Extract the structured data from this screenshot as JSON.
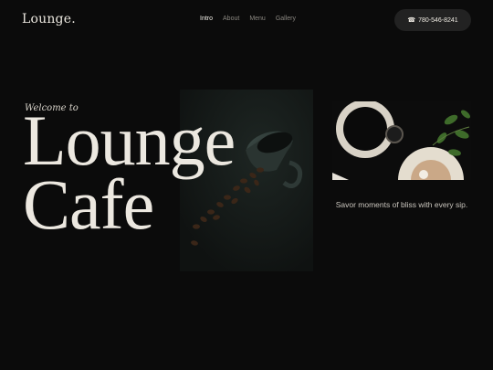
{
  "header": {
    "logo": "Lounge.",
    "nav": [
      {
        "label": "Intro",
        "active": true
      },
      {
        "label": "About",
        "active": false
      },
      {
        "label": "Menu",
        "active": false
      },
      {
        "label": "Gallery",
        "active": false
      }
    ],
    "phone": "780-546-8241",
    "phone_icon": "phone-icon"
  },
  "hero": {
    "welcome": "Welcome to",
    "title_line1": "Lounge",
    "title_line2": "Cafe",
    "tagline": "Savor moments of bliss with every sip."
  },
  "images": {
    "main": "coffee-cup-beans-photo",
    "side": "coffee-cups-plant-photo"
  },
  "colors": {
    "background": "#0b0b0b",
    "text": "#ece8e0",
    "muted": "#8a8780",
    "button": "#222222"
  }
}
